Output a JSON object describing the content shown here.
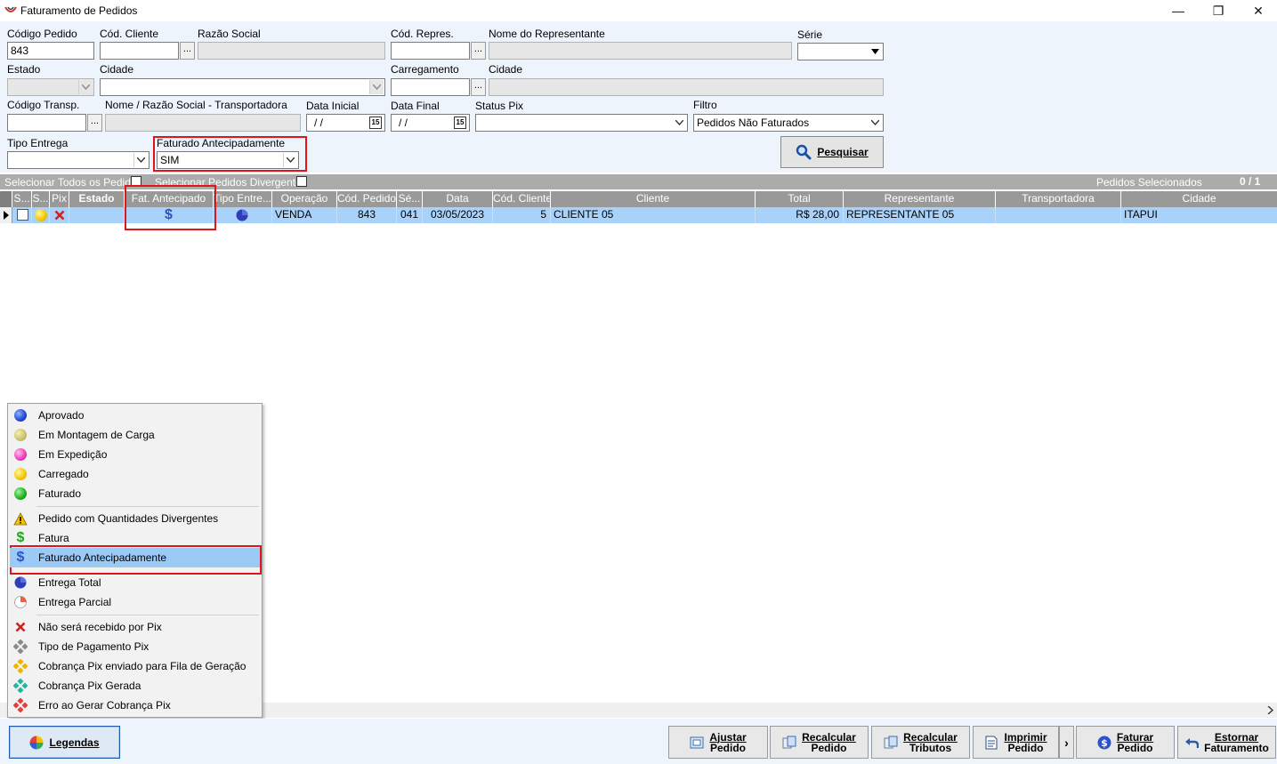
{
  "window": {
    "title": "Faturamento de Pedidos",
    "minimize": "—",
    "maximize": "❐",
    "close": "✕"
  },
  "filters": {
    "codigo_pedido_label": "Código Pedido",
    "codigo_pedido_value": "843",
    "cod_cliente_label": "Cód. Cliente",
    "razao_social_label": "Razão Social",
    "cod_repres_label": "Cód. Repres.",
    "nome_representante_label": "Nome do Representante",
    "serie_label": "Série",
    "estado_label": "Estado",
    "cidade_label": "Cidade",
    "carregamento_label": "Carregamento",
    "cidade2_label": "Cidade",
    "codigo_transp_label": "Código Transp.",
    "nome_transp_label": "Nome / Razão Social - Transportadora",
    "data_inicial_label": "Data Inicial",
    "data_inicial_value": " / /",
    "data_final_label": "Data Final",
    "data_final_value": " / /",
    "status_pix_label": "Status Pix",
    "filtro_label": "Filtro",
    "filtro_value": "Pedidos Não Faturados",
    "tipo_entrega_label": "Tipo Entrega",
    "faturado_antecip_label": "Faturado Antecipadamente",
    "faturado_antecip_value": "SIM",
    "ellipsis": "...",
    "calendar": "15",
    "pesquisar_label": "Pesquisar"
  },
  "selection": {
    "select_all_label": "Selecionar Todos os Pedidos",
    "select_divergent_label": "Selecionar Pedidos Divergentes",
    "selected_label": "Pedidos Selecionados",
    "selected_count": "0 / 1"
  },
  "grid": {
    "columns": [
      "S...",
      "S...",
      "Pix",
      "Estado",
      "Fat. Antecipado",
      "Tipo Entre...",
      "Operação",
      "Cód. Pedido",
      "Sé...",
      "Data",
      "Cód. Cliente",
      "Cliente",
      "Total",
      "Representante",
      "Transportadora",
      "Cidade"
    ],
    "rows": [
      {
        "operacao": "VENDA",
        "cod_pedido": "843",
        "serie": "041",
        "data": "03/05/2023",
        "cod_cliente": "5",
        "cliente": "CLIENTE 05",
        "total": "R$ 28,00",
        "representante": "REPRESENTANTE 05",
        "transportadora": "",
        "cidade": "ITAPUI",
        "fat_antecipado_icon": "dollar-icon",
        "tipo_entrega_icon": "pie-full-icon",
        "status_icon": "yellow-dot-icon",
        "pix_icon": "red-x-icon"
      }
    ]
  },
  "legend": {
    "items": [
      {
        "label": "Aprovado",
        "icon": "blue-dot-icon"
      },
      {
        "label": "Em Montagem de Carga",
        "icon": "olive-dot-icon"
      },
      {
        "label": "Em Expedição",
        "icon": "pink-dot-icon"
      },
      {
        "label": "Carregado",
        "icon": "yellow-dot-icon"
      },
      {
        "label": "Faturado",
        "icon": "green-dot-icon"
      },
      {
        "label": "Pedido com Quantidades Divergentes",
        "icon": "warning-icon"
      },
      {
        "label": "Fatura",
        "icon": "green-dollar-icon"
      },
      {
        "label": "Faturado Antecipadamente",
        "icon": "blue-dollar-icon"
      },
      {
        "label": "Entrega Total",
        "icon": "pie-full-icon"
      },
      {
        "label": "Entrega Parcial",
        "icon": "pie-partial-icon"
      },
      {
        "label": "Não será recebido por Pix",
        "icon": "red-x-icon"
      },
      {
        "label": "Tipo de Pagamento Pix",
        "icon": "gray-pix-icon"
      },
      {
        "label": "Cobrança Pix enviado para Fila de Geração",
        "icon": "orange-pix-icon"
      },
      {
        "label": "Cobrança Pix Gerada",
        "icon": "teal-pix-icon"
      },
      {
        "label": "Erro ao Gerar Cobrança Pix",
        "icon": "red-pix-icon"
      }
    ]
  },
  "bottom": {
    "legendas_label": "Legendas",
    "ajustar_1": "Ajustar",
    "ajustar_2": "Pedido",
    "recalc_pedido_1": "Recalcular",
    "recalc_pedido_2": "Pedido",
    "recalc_trib_1": "Recalcular",
    "recalc_trib_2": "Tributos",
    "imprimir_1": "Imprimir",
    "imprimir_2": "Pedido",
    "more": "›",
    "faturar_1": "Faturar",
    "faturar_2": "Pedido",
    "estornar_1": "Estornar",
    "estornar_2": "Faturamento"
  },
  "colors": {
    "highlight_red": "#e0141b",
    "row_selected": "#a9d2fb",
    "header_gray": "#999999",
    "panel_bg": "#eef4fb"
  }
}
